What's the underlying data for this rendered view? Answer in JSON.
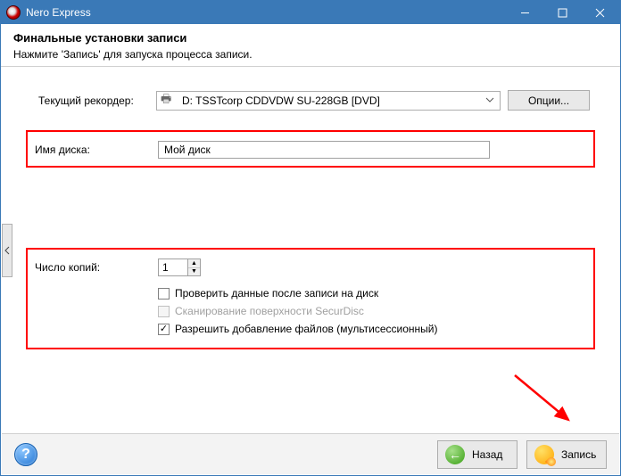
{
  "window": {
    "title": "Nero Express"
  },
  "header": {
    "title": "Финальные установки записи",
    "subtitle": "Нажмите 'Запись' для запуска процесса записи."
  },
  "recorder": {
    "label": "Текущий рекордер:",
    "value": "D: TSSTcorp CDDVDW SU-228GB   [DVD]",
    "options_button": "Опции..."
  },
  "disc": {
    "label": "Имя диска:",
    "value": "Мой диск"
  },
  "copies": {
    "label": "Число копий:",
    "value": "1"
  },
  "checks": {
    "verify": {
      "label": "Проверить данные после записи на диск",
      "checked": false
    },
    "securdisc": {
      "label": "Сканирование поверхности SecurDisc",
      "checked": false,
      "disabled": true
    },
    "multisession": {
      "label": "Разрешить добавление файлов (мультисессионный)",
      "checked": true
    }
  },
  "footer": {
    "back": "Назад",
    "burn": "Запись"
  }
}
